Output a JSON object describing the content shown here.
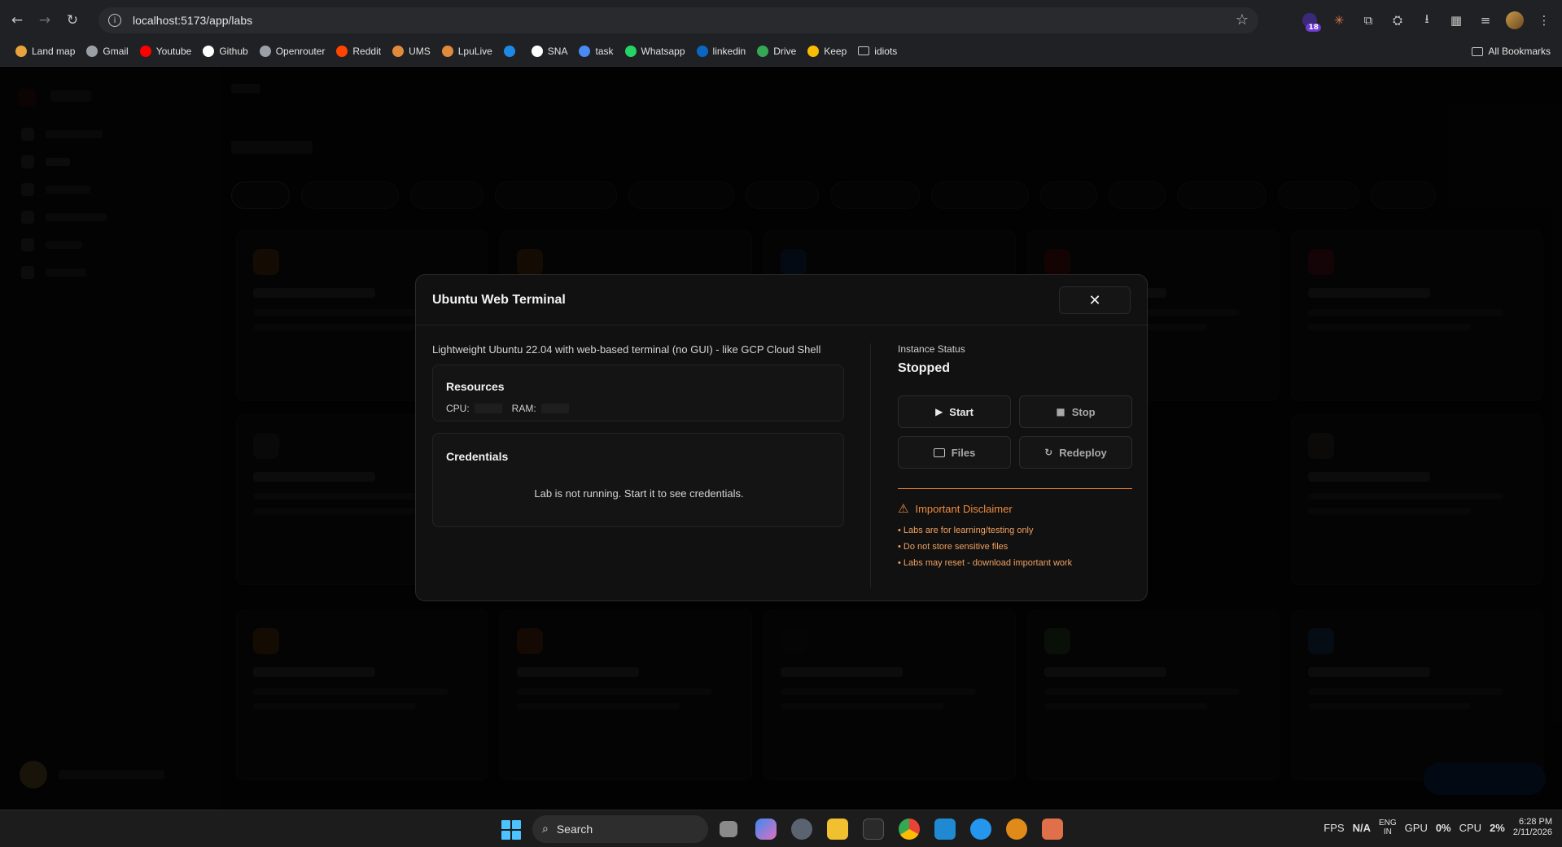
{
  "browser": {
    "url": "localhost:5173/app/labs",
    "extension_badge": "18",
    "bookmarks": [
      {
        "label": "Land map",
        "icon": "globe-icon",
        "color": "#e8a33d"
      },
      {
        "label": "Gmail",
        "icon": "globe-icon",
        "color": "#9aa0a6"
      },
      {
        "label": "Youtube",
        "icon": "youtube-icon",
        "color": "#ff0000"
      },
      {
        "label": "Github",
        "icon": "github-icon",
        "color": "#ffffff"
      },
      {
        "label": "Openrouter",
        "icon": "openrouter-icon",
        "color": "#9aa0a6"
      },
      {
        "label": "Reddit",
        "icon": "reddit-icon",
        "color": "#ff4500"
      },
      {
        "label": "UMS",
        "icon": "ums-icon",
        "color": "#e08a3c"
      },
      {
        "label": "LpuLive",
        "icon": "lpulive-icon",
        "color": "#e08a3c"
      },
      {
        "label": "",
        "icon": "s-icon",
        "color": "#1e88e5"
      },
      {
        "label": "SNA",
        "icon": "sna-icon",
        "color": "#ffffff"
      },
      {
        "label": "task",
        "icon": "task-icon",
        "color": "#4a8af4"
      },
      {
        "label": "Whatsapp",
        "icon": "whatsapp-icon",
        "color": "#25d366"
      },
      {
        "label": "linkedin",
        "icon": "linkedin-icon",
        "color": "#0a66c2"
      },
      {
        "label": "Drive",
        "icon": "drive-icon",
        "color": "#34a853"
      },
      {
        "label": "Keep",
        "icon": "keep-icon",
        "color": "#fbbc04"
      },
      {
        "label": "idiots",
        "icon": "folder-icon",
        "color": "#c4c7c5"
      }
    ],
    "all_bookmarks": "All Bookmarks"
  },
  "modal": {
    "title": "Ubuntu Web Terminal",
    "close_glyph": "✕",
    "description": "Lightweight Ubuntu 22.04 with web-based terminal (no GUI) - like GCP Cloud Shell",
    "resources": {
      "heading": "Resources",
      "cpu_label": "CPU:",
      "ram_label": "RAM:"
    },
    "credentials": {
      "heading": "Credentials",
      "message": "Lab is not running. Start it to see credentials."
    },
    "instance": {
      "status_label": "Instance Status",
      "status_value": "Stopped"
    },
    "actions": {
      "start": "Start",
      "stop": "Stop",
      "files": "Files",
      "redeploy": "Redeploy"
    },
    "disclaimer": {
      "title": "Important Disclaimer",
      "items": [
        "• Labs are for learning/testing only",
        "• Do not store sensitive files",
        "• Labs may reset - download important work"
      ],
      "color": "#f08a3c"
    }
  },
  "taskbar": {
    "search": "Search",
    "fps": "FPS",
    "fps_value": "N/A",
    "lang_top": "ENG",
    "lang_bottom": "IN",
    "gpu": "GPU",
    "gpu_value": "0%",
    "cpu": "CPU",
    "cpu_value": "2%",
    "time": "6:28 PM",
    "date": "2/11/2026"
  },
  "colors": {
    "accent_orange": "#e07a2e",
    "modal_bg": "#111111",
    "page_bg": "#000000"
  }
}
